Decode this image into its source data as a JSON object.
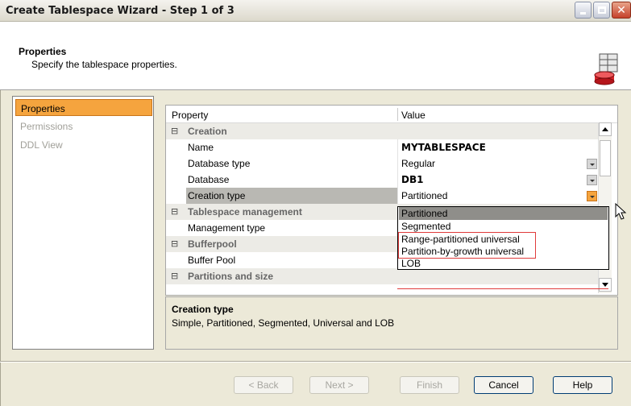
{
  "window": {
    "title": "Create Tablespace Wizard - Step 1 of 3"
  },
  "header": {
    "title": "Properties",
    "subtitle": "Specify the tablespace properties."
  },
  "nav": {
    "items": [
      {
        "label": "Properties",
        "active": true
      },
      {
        "label": "Permissions",
        "active": false
      },
      {
        "label": "DDL View",
        "active": false
      }
    ]
  },
  "grid": {
    "col_property": "Property",
    "col_value": "Value",
    "rows": [
      {
        "kind": "category",
        "label": "Creation"
      },
      {
        "kind": "prop",
        "name": "Name",
        "value": "MYTABLESPACE",
        "bold": true
      },
      {
        "kind": "prop",
        "name": "Database type",
        "value": "Regular",
        "dropdown": true
      },
      {
        "kind": "prop",
        "name": "Database",
        "value": "DB1",
        "bold": true,
        "dropdown": true
      },
      {
        "kind": "prop",
        "name": "Creation type",
        "value": "Partitioned",
        "selected": true,
        "dropdown": true,
        "dropdown_hot": true
      },
      {
        "kind": "category",
        "label": "Tablespace management"
      },
      {
        "kind": "prop",
        "name": "Management type",
        "value": ""
      },
      {
        "kind": "category",
        "label": "Bufferpool"
      },
      {
        "kind": "prop",
        "name": "Buffer Pool",
        "value": ""
      },
      {
        "kind": "category",
        "label": "Partitions and size"
      }
    ]
  },
  "dropdown": {
    "options": [
      "Partitioned",
      "Segmented",
      "Range-partitioned universal",
      "Partition-by-growth universal",
      "LOB"
    ],
    "selected": "Partitioned"
  },
  "description": {
    "title": "Creation type",
    "text": "Simple, Partitioned, Segmented, Universal and LOB"
  },
  "buttons": {
    "back": "< Back",
    "next": "Next >",
    "finish": "Finish",
    "cancel": "Cancel",
    "help": "Help"
  },
  "colors": {
    "accent": "#f5a43e",
    "highlight_box": "#e03b3b"
  }
}
